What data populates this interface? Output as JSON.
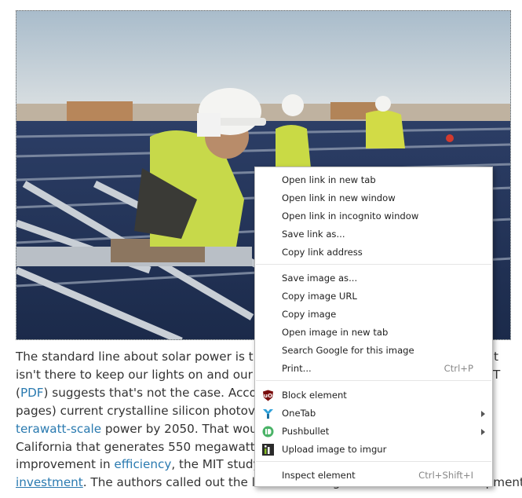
{
  "article": {
    "lines": [
      [
        "The standard line about solar power is tha",
        "",
        "",
        "t"
      ],
      [
        "isn't there to keep our lights on and our N",
        "",
        "",
        "T"
      ],
      [
        "(",
        "PDF",
        ") suggests that's not the case. Accord",
        ""
      ],
      [
        "pages) current crystalline silicon photovol",
        "",
        "",
        ""
      ],
      [
        "",
        "terawatt-scale",
        " power by 2050. That would",
        ""
      ],
      [
        "California that generates 550 megawatts. ",
        "",
        "",
        ""
      ],
      [
        "improvement in ",
        "efficiency",
        ", the MIT study s",
        ""
      ],
      [
        "",
        "investment",
        ". The authors called out the lack of funding for research and development",
        ""
      ]
    ]
  },
  "context_menu": {
    "items": [
      {
        "label": "Open link in new tab"
      },
      {
        "label": "Open link in new window"
      },
      {
        "label": "Open link in incognito window"
      },
      {
        "label": "Save link as..."
      },
      {
        "label": "Copy link address"
      },
      {
        "label": "Save image as..."
      },
      {
        "label": "Copy image URL"
      },
      {
        "label": "Copy image"
      },
      {
        "label": "Open image in new tab"
      },
      {
        "label": "Search Google for this image"
      },
      {
        "label": "Print...",
        "shortcut": "Ctrl+P"
      },
      {
        "label": "Block element",
        "icon": "ublock-icon"
      },
      {
        "label": "OneTab",
        "icon": "onetab-icon",
        "submenu": true
      },
      {
        "label": "Pushbullet",
        "icon": "pushbullet-icon",
        "submenu": true
      },
      {
        "label": "Upload image to imgur",
        "icon": "imgur-icon"
      },
      {
        "label": "Inspect element",
        "shortcut": "Ctrl+Shift+I"
      }
    ]
  },
  "colors": {
    "link": "#2a7ab0",
    "text": "#333333"
  }
}
